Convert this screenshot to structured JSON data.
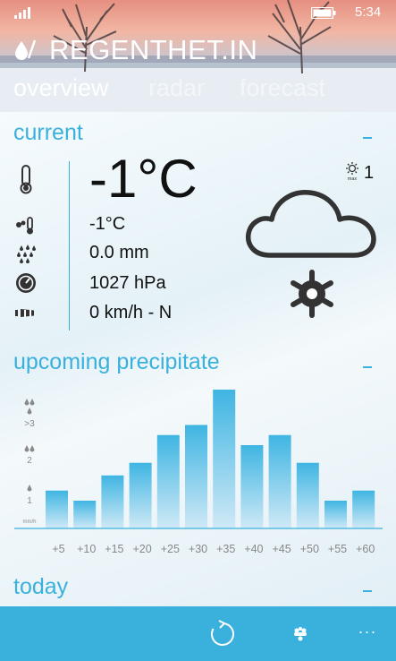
{
  "status_bar": {
    "time": "5:34"
  },
  "app": {
    "title": "REGENTHET.IN"
  },
  "pivots": [
    {
      "label": "overview",
      "active": true
    },
    {
      "label": "radar",
      "active": false
    },
    {
      "label": "forecast",
      "active": false
    }
  ],
  "current": {
    "title": "current",
    "temperature": "-1°C",
    "uv_index": "1",
    "uv_icon_label": "max",
    "rows": [
      {
        "icon": "feels-like-icon",
        "value": "-1°C"
      },
      {
        "icon": "rain-amount-icon",
        "value": "0.0 mm"
      },
      {
        "icon": "pressure-icon",
        "value": "1027 hPa"
      },
      {
        "icon": "wind-icon",
        "value": "0 km/h - N"
      }
    ],
    "condition_icon": "cloud-snow-icon"
  },
  "precipitation": {
    "title": "upcoming precipitate",
    "legend": [
      ">3",
      "2",
      "1"
    ],
    "unit": "mm/h"
  },
  "chart_data": {
    "type": "bar",
    "categories": [
      "+5",
      "+10",
      "+15",
      "+20",
      "+25",
      "+30",
      "+35",
      "+40",
      "+45",
      "+50",
      "+55",
      "+60"
    ],
    "values": [
      1.5,
      1.1,
      2.1,
      2.6,
      3.7,
      4.1,
      5.5,
      3.3,
      3.7,
      2.6,
      1.1,
      1.5
    ],
    "ylim": [
      0,
      5.5
    ],
    "grid": false,
    "colors": {
      "bar_top": "#3fb5e2",
      "bar_bottom": "#cfe9f6",
      "baseline": "#3ab1dc"
    }
  },
  "today": {
    "title": "today"
  },
  "app_bar": {
    "refresh_icon": "refresh-icon",
    "radar_icon": "radar-icon",
    "more_label": "..."
  },
  "colors": {
    "accent": "#3ab1dc",
    "app_bar": "#3ab1dc"
  }
}
